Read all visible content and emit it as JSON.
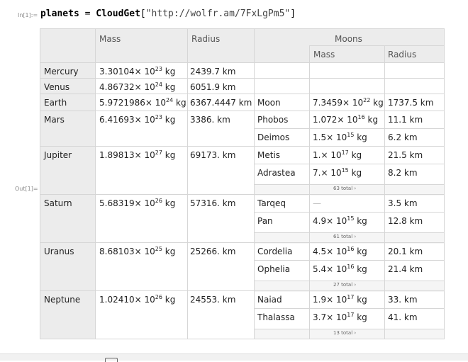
{
  "cell_in_label": "In[1]:=",
  "cell_out_label": "Out[1]=",
  "input": {
    "var": "planets",
    "op": " = ",
    "fn": "CloudGet",
    "open": "[",
    "arg": "\"http://wolfr.am/7FxLgPm5\"",
    "close": "]"
  },
  "headers": {
    "mass": "Mass",
    "radius": "Radius",
    "moons": "Moons",
    "moon_mass": "Mass",
    "moon_radius": "Radius"
  },
  "planets": [
    {
      "name": "Mercury",
      "mass_m": "3.30104",
      "mass_e": "23",
      "radius": "2439.7 km"
    },
    {
      "name": "Venus",
      "mass_m": "4.86732",
      "mass_e": "24",
      "radius": "6051.9 km"
    },
    {
      "name": "Earth",
      "mass_m": "5.9721986",
      "mass_e": "24",
      "radius": "6367.4447 km"
    },
    {
      "name": "Mars",
      "mass_m": "6.41693",
      "mass_e": "23",
      "radius": "3386. km"
    },
    {
      "name": "Jupiter",
      "mass_m": "1.89813",
      "mass_e": "27",
      "radius": "69173. km"
    },
    {
      "name": "Saturn",
      "mass_m": "5.68319",
      "mass_e": "26",
      "radius": "57316. km"
    },
    {
      "name": "Uranus",
      "mass_m": "8.68103",
      "mass_e": "25",
      "radius": "25266. km"
    },
    {
      "name": "Neptune",
      "mass_m": "1.02410",
      "mass_e": "26",
      "radius": "24553. km"
    }
  ],
  "moons": [
    {
      "name": "Moon",
      "mass_m": "7.3459",
      "mass_e": "22",
      "radius": "1737.5 km"
    },
    {
      "name": "Phobos",
      "mass_m": "1.072",
      "mass_e": "16",
      "radius": "11.1 km"
    },
    {
      "name": "Deimos",
      "mass_m": "1.5",
      "mass_e": "15",
      "radius": "6.2 km"
    },
    {
      "name": "Metis",
      "mass_m": "1.",
      "mass_e": "17",
      "radius": "21.5 km"
    },
    {
      "name": "Adrastea",
      "mass_m": "7.",
      "mass_e": "15",
      "radius": "8.2 km"
    },
    {
      "name": "Tarqeq",
      "mass_text": "—",
      "radius": "3.5 km"
    },
    {
      "name": "Pan",
      "mass_m": "4.9",
      "mass_e": "15",
      "radius": "12.8 km"
    },
    {
      "name": "Cordelia",
      "mass_m": "4.5",
      "mass_e": "16",
      "radius": "20.1 km"
    },
    {
      "name": "Ophelia",
      "mass_m": "5.4",
      "mass_e": "16",
      "radius": "21.4 km"
    },
    {
      "name": "Naiad",
      "mass_m": "1.9",
      "mass_e": "17",
      "radius": "33. km"
    },
    {
      "name": "Thalassa",
      "mass_m": "3.7",
      "mass_e": "17",
      "radius": "41. km"
    }
  ],
  "totals": {
    "jupiter": "63 total ›",
    "saturn": "61 total ›",
    "uranus": "27 total ›",
    "neptune": "13 total ›"
  },
  "units": {
    "kg": "kg",
    "times10": "× 10"
  },
  "colors": {
    "header_bg": "#ececec",
    "row_bg": "#f5f5f5",
    "grid_line": "#d6d6d6"
  }
}
